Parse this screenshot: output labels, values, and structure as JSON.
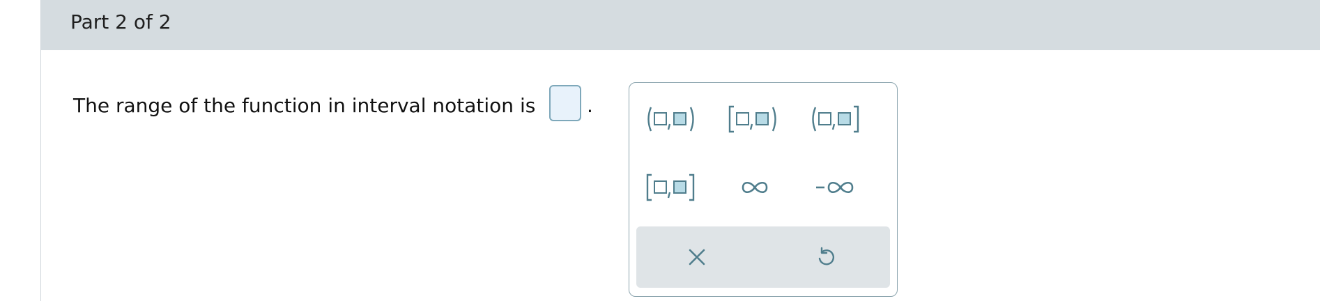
{
  "header": {
    "part_label": "Part 2 of 2"
  },
  "question": {
    "text": "The range of the function in interval notation is",
    "trailing_punctuation": "."
  },
  "palette": {
    "buttons": [
      {
        "name": "open-open-interval",
        "glyph": "(□,□)"
      },
      {
        "name": "closed-open-interval",
        "glyph": "[□,□)"
      },
      {
        "name": "open-closed-interval",
        "glyph": "(□,□]"
      },
      {
        "name": "closed-closed-interval",
        "glyph": "[□,□]"
      },
      {
        "name": "infinity",
        "glyph": "∞"
      },
      {
        "name": "negative-infinity",
        "glyph": "-∞"
      }
    ],
    "actions": [
      {
        "name": "clear",
        "icon": "close-icon"
      },
      {
        "name": "undo",
        "icon": "undo-icon"
      }
    ]
  },
  "colors": {
    "header_bg": "#d5dce0",
    "accent": "#4f7d8c",
    "answer_box_fill": "#e8f2fb",
    "slot_fill": "#b8dbe6",
    "bar_bg": "#dfe4e7"
  }
}
